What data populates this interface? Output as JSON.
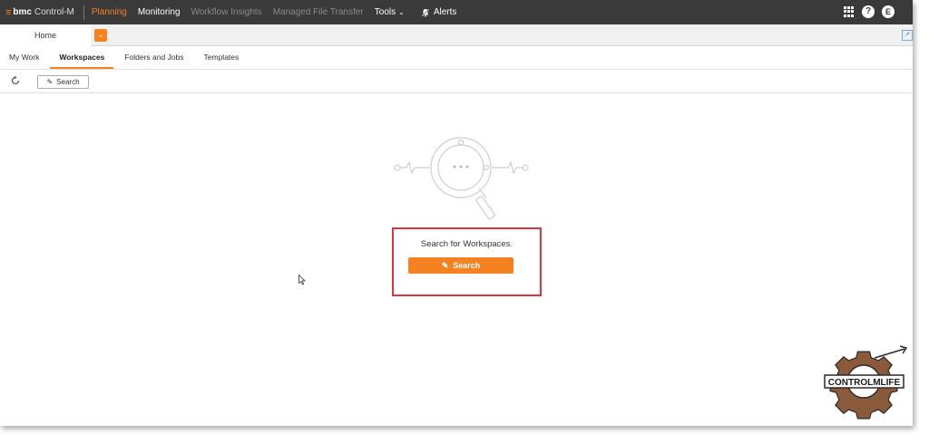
{
  "header": {
    "brand": "bmc",
    "product": "Control-M",
    "nav": [
      {
        "label": "Planning",
        "state": "active"
      },
      {
        "label": "Monitoring",
        "state": "normal"
      },
      {
        "label": "Workflow Insights",
        "state": "dim"
      },
      {
        "label": "Managed File Transfer",
        "state": "dim"
      }
    ],
    "tools_label": "Tools",
    "alerts_label": "Alerts",
    "user_initial": "E",
    "help_glyph": "?"
  },
  "tabs": {
    "home_label": "Home"
  },
  "subnav": {
    "items": [
      "My Work",
      "Workspaces",
      "Folders and Jobs",
      "Templates"
    ],
    "active": "Workspaces"
  },
  "toolbar": {
    "search_label": "Search"
  },
  "empty_state": {
    "message": "Search for Workspaces.",
    "button_label": "Search"
  },
  "watermark": {
    "text": "CONTROLMLIFE"
  },
  "colors": {
    "accent": "#f58220",
    "nav_bg": "#3a3a3a",
    "highlight": "#d9363e"
  },
  "icons": [
    "bmc-logo-icon",
    "chevron-down-icon",
    "bell-slash-icon",
    "apps-grid-icon",
    "help-icon",
    "user-avatar-icon",
    "refresh-icon",
    "pencil-icon",
    "search-illustration",
    "mouse-cursor-icon"
  ]
}
